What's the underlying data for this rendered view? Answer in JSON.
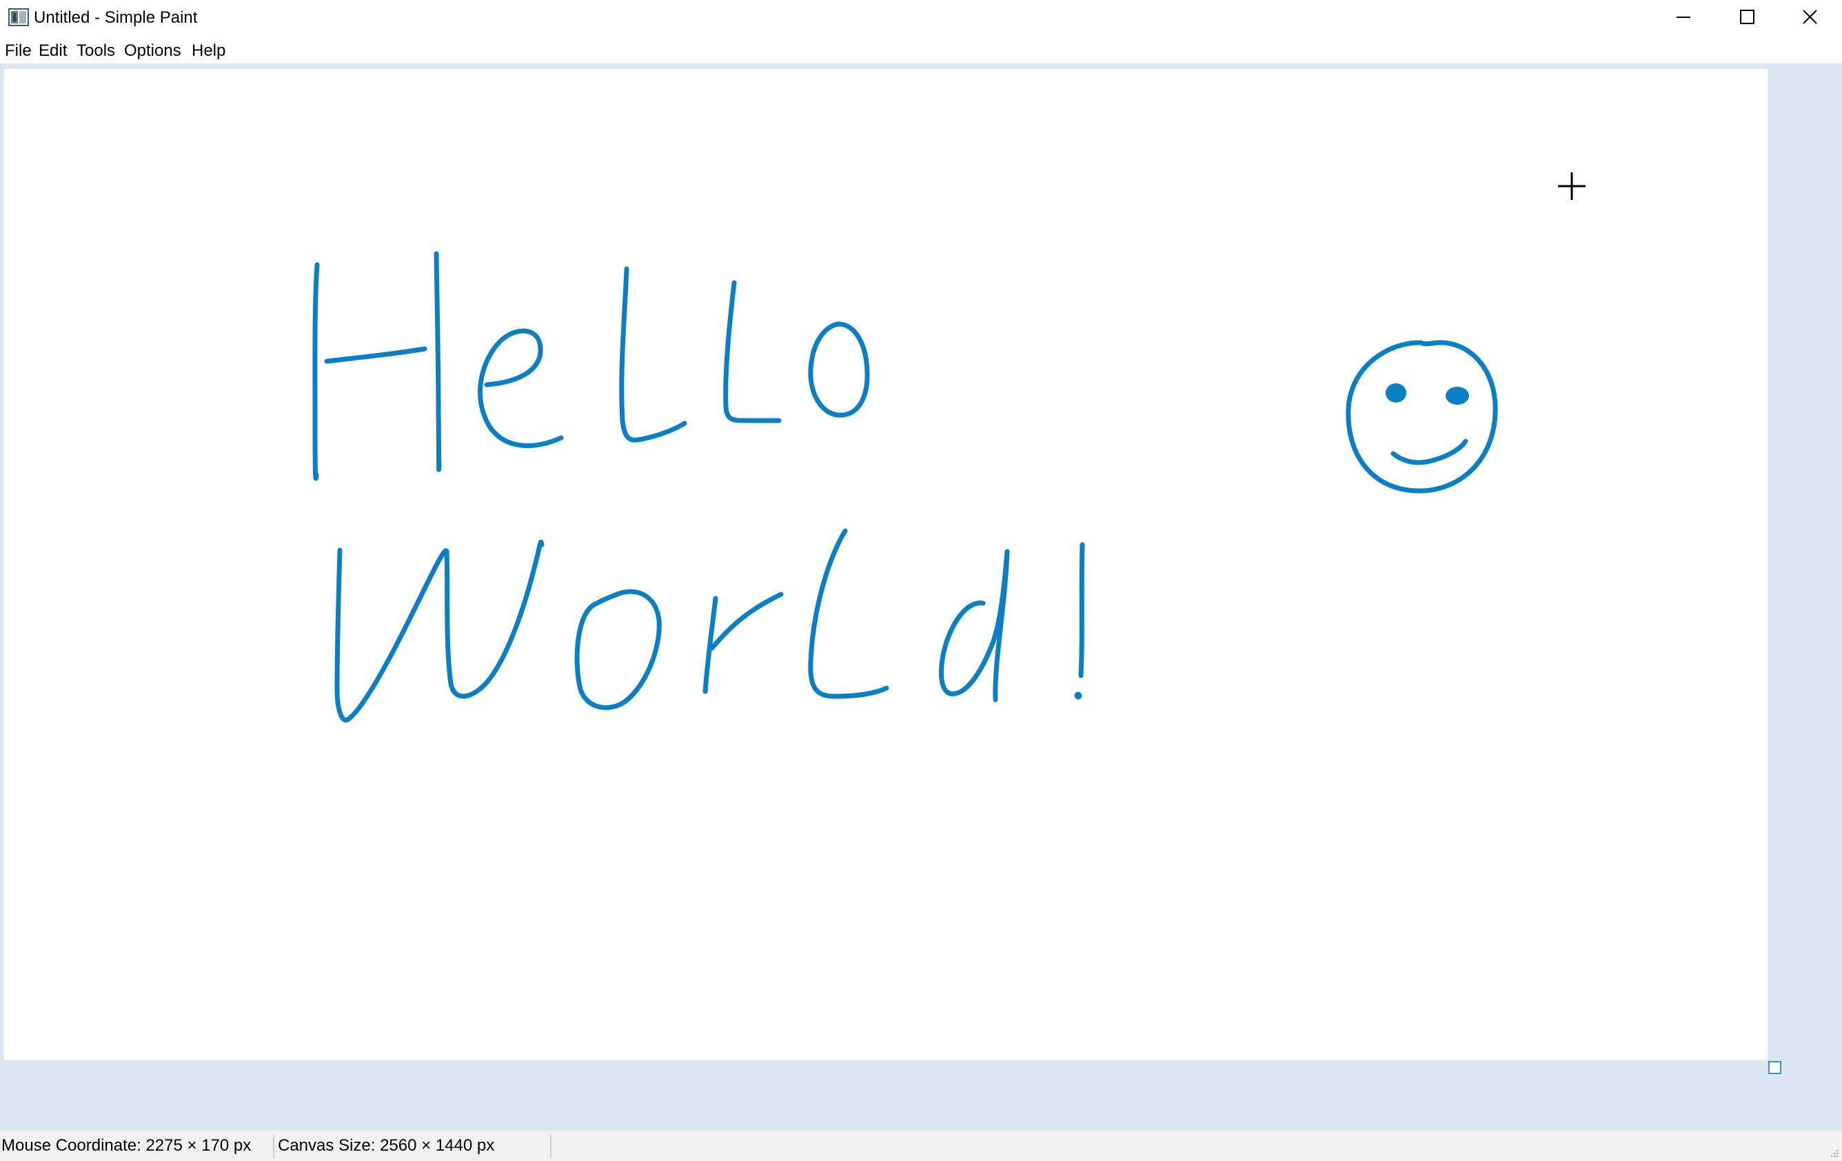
{
  "window": {
    "title": "Untitled - Simple Paint"
  },
  "menu": {
    "items": [
      {
        "label": "File"
      },
      {
        "label": "Edit"
      },
      {
        "label": "Tools"
      },
      {
        "label": "Options"
      },
      {
        "label": "Help"
      }
    ]
  },
  "canvas": {
    "background": "#ffffff",
    "stroke_color": "#0a7fc6",
    "drawing_content": [
      "Hello",
      "World!",
      "smiley-face"
    ]
  },
  "colors": {
    "workspace_background": "#dce6f0",
    "statusbar_background": "#f0f0f0",
    "resize_handle_border": "#3c8fd8"
  },
  "icons": {
    "app": "paint-app-icon",
    "minimize": "minimize-icon",
    "maximize": "maximize-icon",
    "close": "close-icon",
    "cursor": "crosshair-cursor-icon",
    "resize_grip": "resize-grip-icon"
  },
  "status": {
    "mouse_coordinate": "Mouse Coordinate: 2275 × 170 px",
    "canvas_size": "Canvas Size: 2560 × 1440 px"
  }
}
